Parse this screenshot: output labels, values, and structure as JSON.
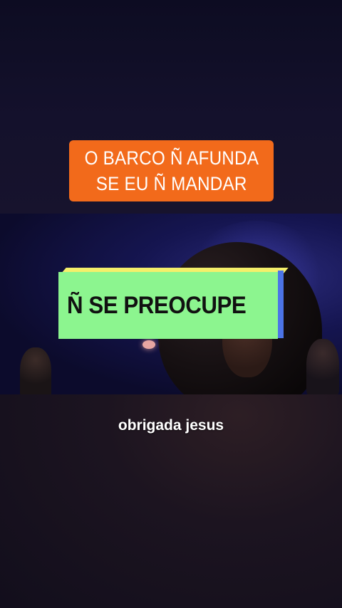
{
  "overlay_top": {
    "line1": "O BARCO Ñ AFUNDA",
    "line2": "SE EU Ñ MANDAR",
    "background": "#f26a1b"
  },
  "overlay_middle": {
    "text": "Ñ SE PREOCUPE",
    "background": "#8cf58f",
    "top_edge_color": "#f4ef6a",
    "side_edge_color": "#4c74e6"
  },
  "subtitle": {
    "text": "obrigada jesus"
  }
}
